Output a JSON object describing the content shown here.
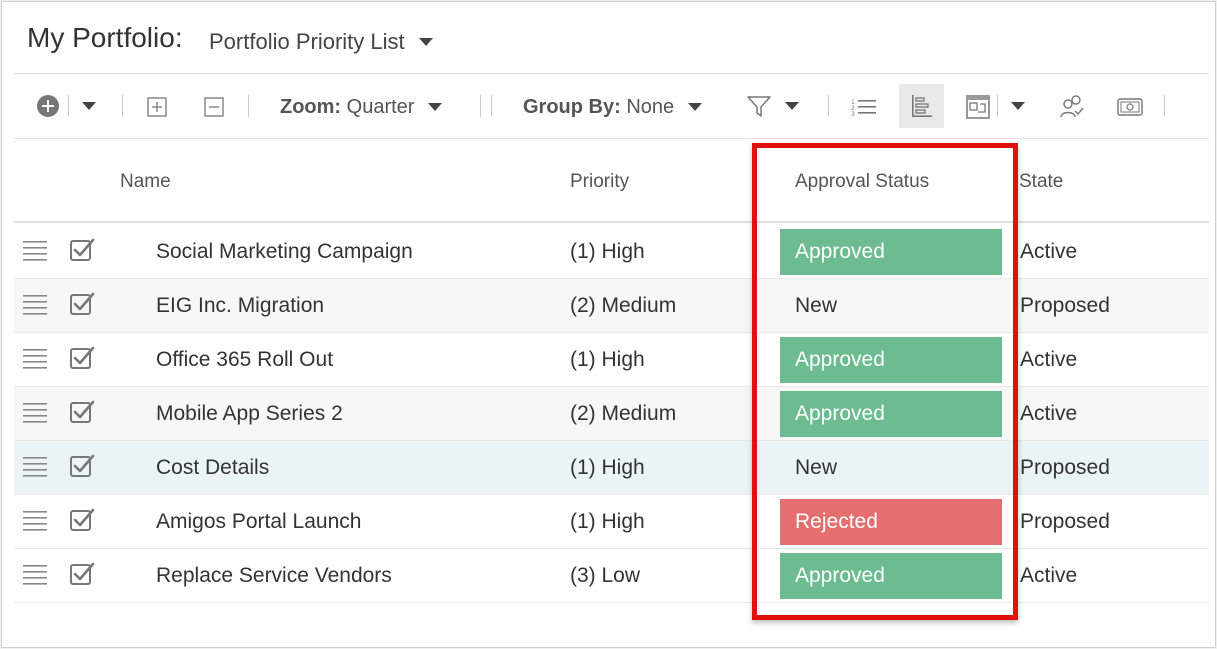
{
  "header": {
    "app_title": "My Portfolio:",
    "view_name": "Portfolio Priority List"
  },
  "toolbar": {
    "zoom_label": "Zoom:",
    "zoom_value": "Quarter",
    "group_label": "Group By:",
    "group_value": "None",
    "icons": [
      "add-circle-icon",
      "expand-icon",
      "collapse-icon",
      "filter-icon",
      "numbered-list-icon",
      "gantt-icon",
      "board-icon",
      "people-icon",
      "money-icon"
    ]
  },
  "columns": {
    "name": "Name",
    "priority": "Priority",
    "approval": "Approval Status",
    "state": "State"
  },
  "rows": [
    {
      "name": "Social Marketing Campaign",
      "priority": "(1) High",
      "approval": "Approved",
      "state": "Active"
    },
    {
      "name": "EIG Inc. Migration",
      "priority": "(2) Medium",
      "approval": "New",
      "state": "Proposed"
    },
    {
      "name": "Office 365 Roll Out",
      "priority": "(1) High",
      "approval": "Approved",
      "state": "Active"
    },
    {
      "name": "Mobile App Series 2",
      "priority": "(2) Medium",
      "approval": "Approved",
      "state": "Active"
    },
    {
      "name": "Cost Details",
      "priority": "(1) High",
      "approval": "New",
      "state": "Proposed"
    },
    {
      "name": "Amigos Portal Launch",
      "priority": "(1) High",
      "approval": "Rejected",
      "state": "Proposed"
    },
    {
      "name": "Replace Service Vendors",
      "priority": "(3) Low",
      "approval": "Approved",
      "state": "Active"
    }
  ],
  "colors": {
    "approved": "#6dbb91",
    "rejected": "#e56f6f",
    "highlight_box": "#e01010"
  }
}
